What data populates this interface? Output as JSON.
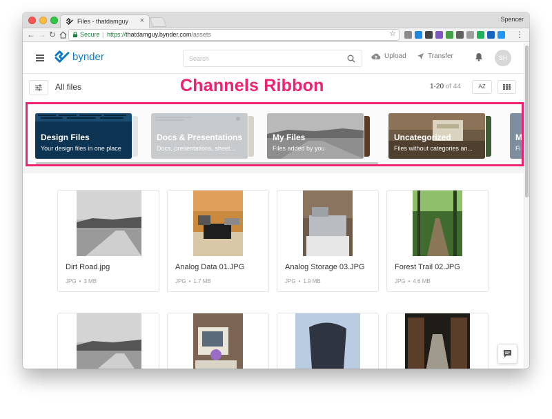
{
  "browser": {
    "tab_title": "Files - thatdamguy",
    "profile_name": "Spencer",
    "secure_label": "Secure",
    "url_scheme": "https://",
    "url_host": "thatdamguy.bynder.com",
    "url_path": "/assets",
    "extension_colors": [
      "#8a8a8a",
      "#1e88e5",
      "#444444",
      "#7e57c2",
      "#43a047",
      "#616161",
      "#9e9e9e",
      "#20b256",
      "#1565c0",
      "#2196f3"
    ]
  },
  "header": {
    "logo_text": "bynder",
    "search_placeholder": "Search",
    "upload_label": "Upload",
    "transfer_label": "Transfer",
    "avatar_initials": "SH"
  },
  "toolbar": {
    "title": "All files",
    "range": "1-20",
    "of_label": "of",
    "total": "44",
    "sort_label": "AZ"
  },
  "annotation": "Channels Ribbon",
  "channels": [
    {
      "title": "Design Files",
      "subtitle": "Your design files in one place"
    },
    {
      "title": "Docs & Presentations",
      "subtitle": "Docs, presentations, sheet..."
    },
    {
      "title": "My Files",
      "subtitle": "Files added by you"
    },
    {
      "title": "Uncategorized",
      "subtitle": "Files without categories an..."
    },
    {
      "title": "M",
      "subtitle": "Fi"
    }
  ],
  "assets": [
    {
      "name": "Dirt Road.jpg",
      "type": "JPG",
      "size": "3 MB"
    },
    {
      "name": "Analog Data 01.JPG",
      "type": "JPG",
      "size": "1.7 MB"
    },
    {
      "name": "Analog Storage 03.JPG",
      "type": "JPG",
      "size": "1.9 MB"
    },
    {
      "name": "Forest Trail 02.JPG",
      "type": "JPG",
      "size": "4.6 MB"
    },
    {
      "name": "",
      "type": "",
      "size": ""
    },
    {
      "name": "",
      "type": "",
      "size": ""
    },
    {
      "name": "",
      "type": "",
      "size": ""
    },
    {
      "name": "",
      "type": "",
      "size": ""
    }
  ],
  "colors": {
    "brand_blue": "#0a7bc1",
    "annotation_pink": "#f0216f",
    "design_channel_bg": "#0d3553"
  }
}
